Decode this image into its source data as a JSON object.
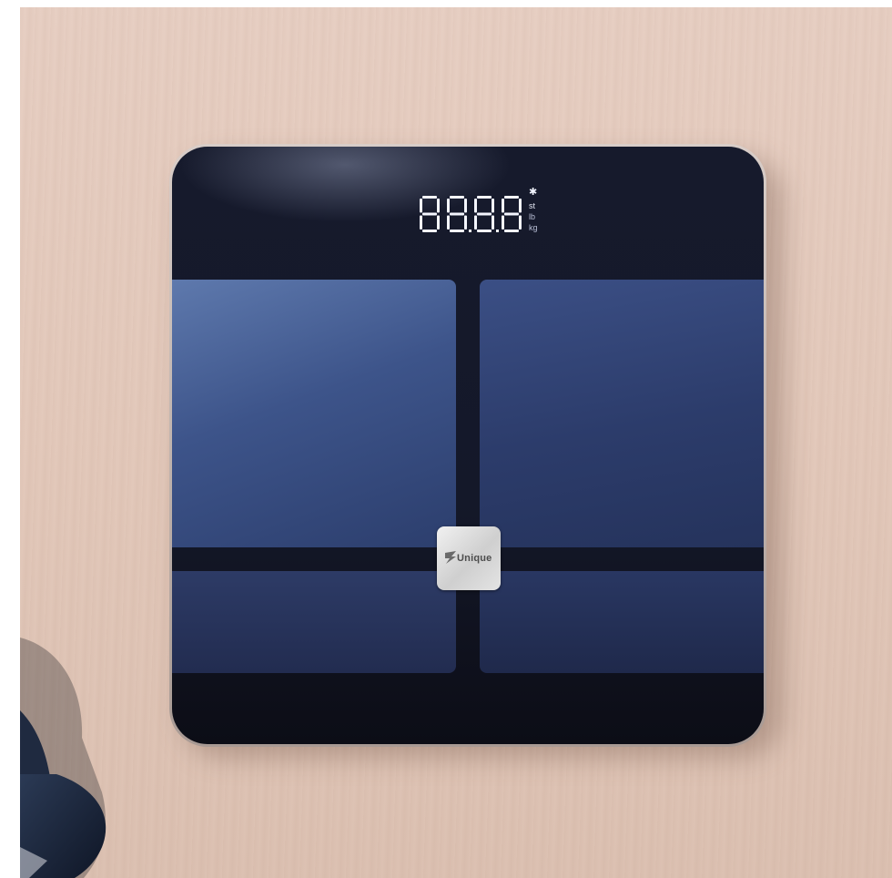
{
  "scene": {
    "description_tag": "bathroom-scale-photo"
  },
  "display": {
    "digits": "88.8.8",
    "bluetooth_symbol": "✱",
    "units": [
      "st",
      "lb",
      "kg"
    ]
  },
  "logo": {
    "brand": "Unique"
  },
  "colors": {
    "floor": "#e3c9bb",
    "glass": "#141829",
    "pad_blue": "#3d548a",
    "display_led": "#f4f6ff",
    "badge": "#dcdcdc"
  }
}
